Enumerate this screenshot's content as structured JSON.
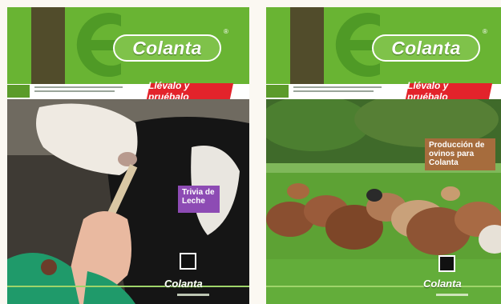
{
  "covers": [
    {
      "brand": "Colanta",
      "slogan": "Llévalo y pruébalo",
      "headline": "Trivia de Leche"
    },
    {
      "brand": "Colanta",
      "slogan": "Llévalo y pruébalo",
      "headline": "Producción de ovinos para Colanta"
    }
  ],
  "colors": {
    "masthead_green": "#69b433",
    "brand_red": "#e3232b",
    "headline_purple": "#8d4bb4",
    "headline_brown": "#a66c3d"
  }
}
